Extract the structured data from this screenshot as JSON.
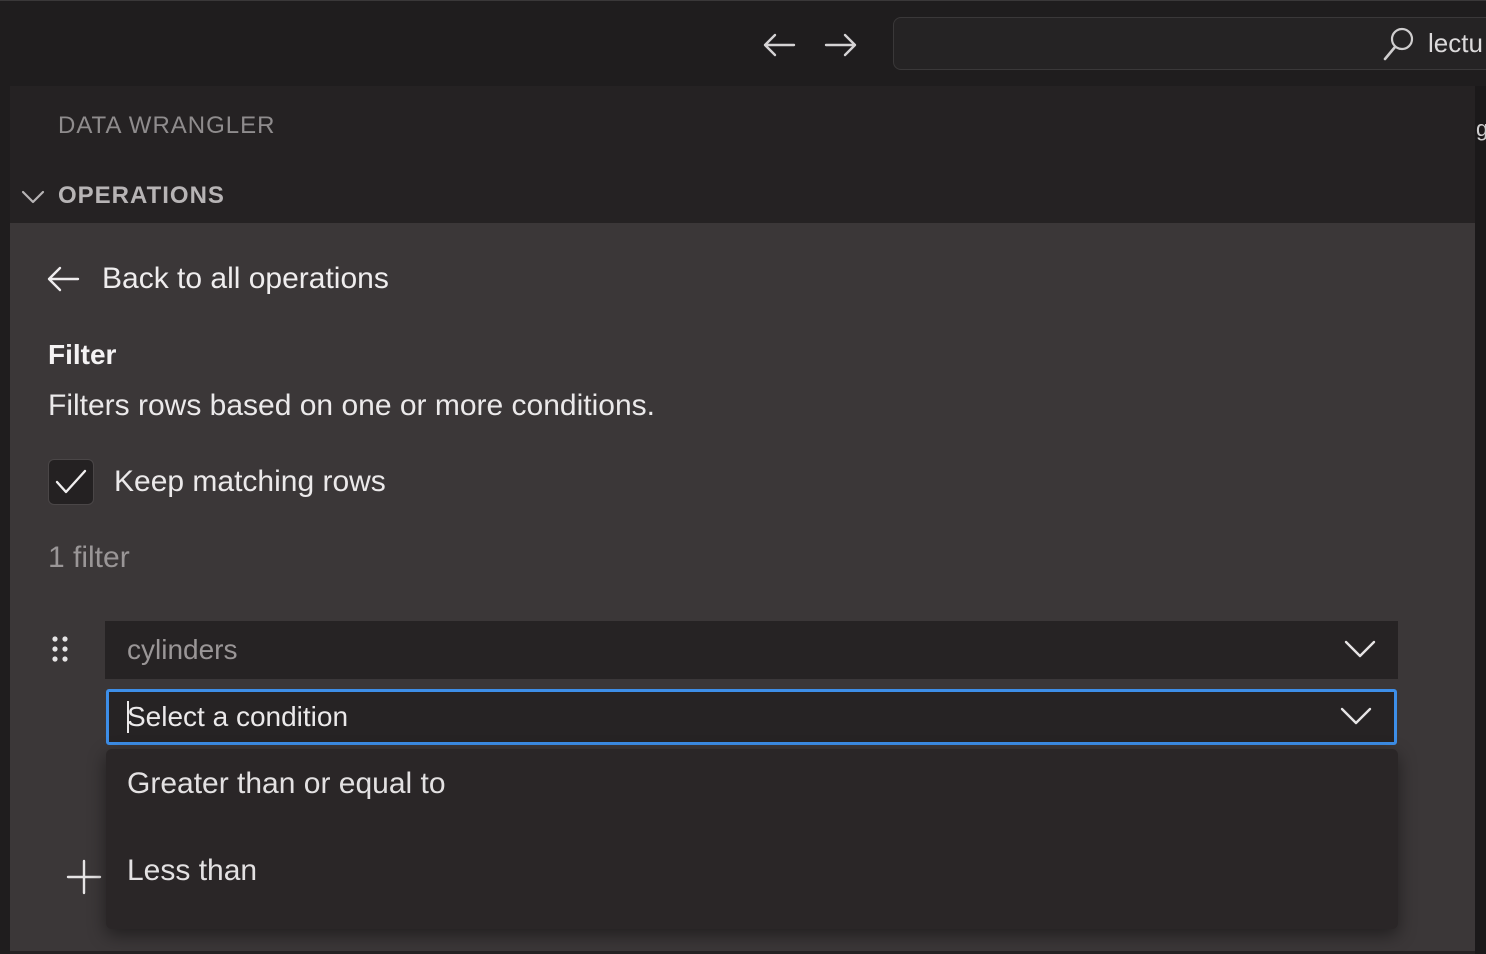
{
  "titlebar": {
    "search_text": "lectu"
  },
  "sidebar": {
    "title": "DATA WRANGLER",
    "section_label": "OPERATIONS"
  },
  "operation": {
    "back_label": "Back to all operations",
    "title": "Filter",
    "description": "Filters rows based on one or more conditions.",
    "keep_matching_label": "Keep matching rows",
    "keep_matching_checked": true,
    "filter_count": "1 filter",
    "column_value": "cylinders",
    "condition_placeholder": "Select a condition",
    "condition_options": [
      "Greater than or equal to",
      "Less than"
    ]
  },
  "colors": {
    "focus_border": "#3d8ee8",
    "panel_bg": "#3b3738",
    "sidebar_bg": "#252223"
  },
  "icons": [
    "arrow-left-icon",
    "arrow-right-icon",
    "search-icon",
    "chevron-down-icon",
    "check-icon",
    "drag-handle-icon",
    "plus-icon"
  ]
}
